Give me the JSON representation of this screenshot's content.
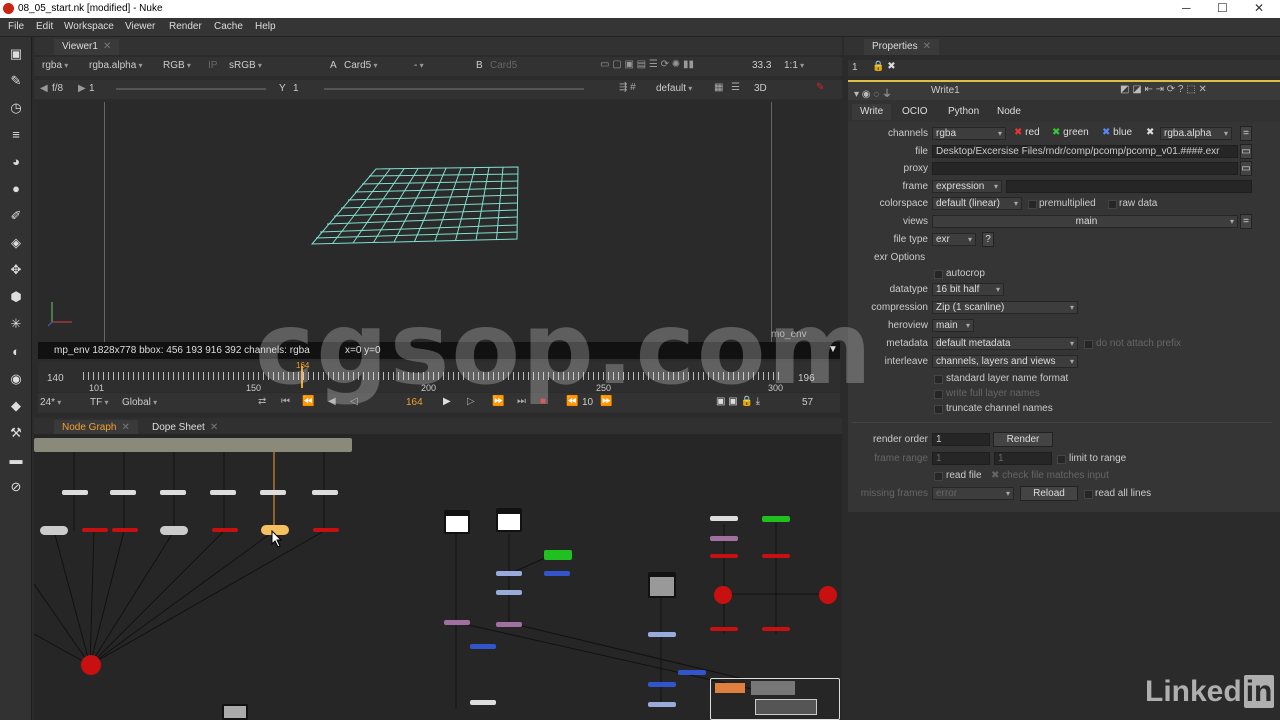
{
  "window": {
    "title": "08_05_start.nk [modified] - Nuke",
    "minimize": "─",
    "maximize": "☐",
    "close": "✕"
  },
  "menu": [
    "File",
    "Edit",
    "Workspace",
    "Viewer",
    "Render",
    "Cache",
    "Help"
  ],
  "toolbar_icons": [
    "image-icon",
    "paint-icon",
    "time-icon",
    "channel-icon",
    "color-icon",
    "filter-icon",
    "keyer-icon",
    "merge-icon",
    "transform-icon",
    "3d-icon",
    "particles-icon",
    "deep-icon",
    "views-icon",
    "metadata-icon",
    "toolsets-icon",
    "other-icon",
    "furnace-icon"
  ],
  "viewer": {
    "tab": "Viewer1",
    "channels": "rgba",
    "alpha": "rgba.alpha",
    "rgb": "RGB",
    "ip": "IP",
    "lut": "sRGB",
    "input_a_label": "A",
    "input_a": "Card5",
    "dash": "-",
    "input_b_label": "B",
    "input_b": "Card5",
    "zoom": "33.3",
    "ratio": "1:1",
    "fstop": "f/8",
    "gain": "1",
    "y_label": "Y",
    "gamma": "1",
    "default": "default",
    "mode": "3D",
    "status": "mp_env 1828x778  bbox: 456 193 916 392 channels: rgba",
    "coords": "x=0 y=0",
    "corner": "mo_env",
    "timeline": {
      "start": "140",
      "end": "196",
      "ticks": [
        "101",
        "150",
        "200",
        "250",
        "300"
      ],
      "cur_marker": "164"
    },
    "fps": "24*",
    "tf": "TF",
    "global": "Global",
    "frame": "164",
    "step": "10",
    "last": "57"
  },
  "nodegraph": {
    "tabs": [
      "Node Graph",
      "Dope Sheet"
    ]
  },
  "properties": {
    "panel_title": "Properties",
    "count": "1",
    "node_name": "Write1",
    "tabs": [
      "Write",
      "OCIO",
      "Python",
      "Node"
    ],
    "channels_label": "channels",
    "channels_value": "rgba",
    "red": "red",
    "green": "green",
    "blue": "blue",
    "alpha_value": "rgba.alpha",
    "file_label": "file",
    "file_value": "Desktop/Excersise Files/rndr/comp/pcomp/pcomp_v01.####.exr",
    "proxy_label": "proxy",
    "frame_label": "frame",
    "frame_value": "expression",
    "colorspace_label": "colorspace",
    "colorspace_value": "default (linear)",
    "premultiplied": "premultiplied",
    "raw_data": "raw data",
    "views_label": "views",
    "views_value": "main",
    "filetype_label": "file type",
    "filetype_value": "exr",
    "help": "?",
    "exr_options": "exr Options",
    "autocrop": "autocrop",
    "datatype_label": "datatype",
    "datatype_value": "16 bit half",
    "compression_label": "compression",
    "compression_value": "Zip (1 scanline)",
    "heroview_label": "heroview",
    "heroview_value": "main",
    "metadata_label": "metadata",
    "metadata_value": "default metadata",
    "no_prefix": "do not attach prefix",
    "interleave_label": "interleave",
    "interleave_value": "channels, layers and views",
    "std_layer": "standard layer name format",
    "write_full": "write full layer names",
    "truncate": "truncate channel names",
    "render_order_label": "render order",
    "render_order_value": "1",
    "render_btn": "Render",
    "limit_range": "limit to range",
    "frame_range_label": "frame range",
    "frame_range_a": "1",
    "frame_range_b": "1",
    "read_file": "read file",
    "check_file": "check file matches input",
    "missing_label": "missing frames",
    "missing_value": "error",
    "reload": "Reload",
    "read_all": "read all lines"
  },
  "watermark": "cgsop.com",
  "brand": {
    "text": "Linked",
    "badge": "in"
  },
  "colors": {
    "accent": "#f0a030",
    "grid": "#7fe0d0",
    "node_red": "#c81010",
    "node_green": "#20c020",
    "node_blue": "#3355cc",
    "node_purple": "#a070a0"
  }
}
